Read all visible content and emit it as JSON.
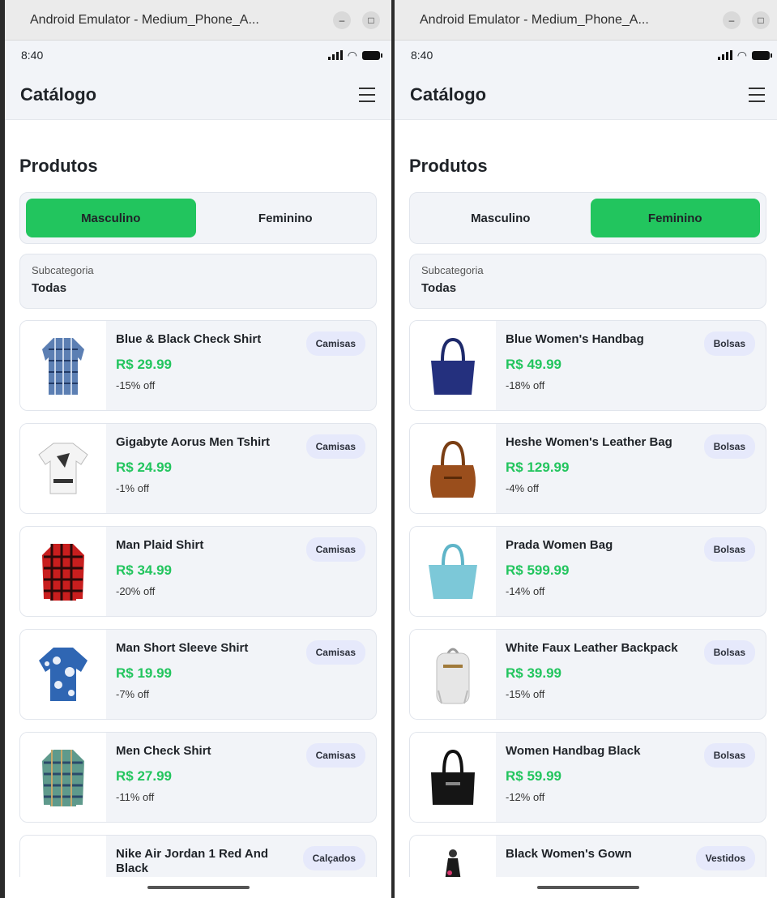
{
  "windows": [
    {
      "title": "Android Emulator - Medium_Phone_A...",
      "status_time": "8:40",
      "app_title": "Catálogo",
      "section_title": "Produtos",
      "segments": [
        {
          "label": "Masculino",
          "active": true
        },
        {
          "label": "Feminino",
          "active": false
        }
      ],
      "subcategory_label": "Subcategoria",
      "subcategory_value": "Todas",
      "products": [
        {
          "name": "Blue & Black Check Shirt",
          "price": "R$ 29.99",
          "discount": "-15% off",
          "category": "Camisas",
          "image": "shirt-blue-check-icon"
        },
        {
          "name": "Gigabyte Aorus Men Tshirt",
          "price": "R$ 24.99",
          "discount": "-1% off",
          "category": "Camisas",
          "image": "tshirt-white-icon"
        },
        {
          "name": "Man Plaid Shirt",
          "price": "R$ 34.99",
          "discount": "-20% off",
          "category": "Camisas",
          "image": "shirt-red-plaid-icon"
        },
        {
          "name": "Man Short Sleeve Shirt",
          "price": "R$ 19.99",
          "discount": "-7% off",
          "category": "Camisas",
          "image": "shirt-blue-floral-icon"
        },
        {
          "name": "Men Check Shirt",
          "price": "R$ 27.99",
          "discount": "-11% off",
          "category": "Camisas",
          "image": "shirt-green-check-icon"
        },
        {
          "name": "Nike Air Jordan 1 Red And Black",
          "price": "",
          "discount": "",
          "category": "Calçados",
          "image": "sneaker-red-black-icon"
        }
      ]
    },
    {
      "title": "Android Emulator - Medium_Phone_A...",
      "status_time": "8:40",
      "app_title": "Catálogo",
      "section_title": "Produtos",
      "segments": [
        {
          "label": "Masculino",
          "active": false
        },
        {
          "label": "Feminino",
          "active": true
        }
      ],
      "subcategory_label": "Subcategoria",
      "subcategory_value": "Todas",
      "products": [
        {
          "name": "Blue Women's Handbag",
          "price": "R$ 49.99",
          "discount": "-18% off",
          "category": "Bolsas",
          "image": "handbag-blue-icon"
        },
        {
          "name": "Heshe Women's Leather Bag",
          "price": "R$ 129.99",
          "discount": "-4% off",
          "category": "Bolsas",
          "image": "handbag-brown-icon"
        },
        {
          "name": "Prada Women Bag",
          "price": "R$ 599.99",
          "discount": "-14% off",
          "category": "Bolsas",
          "image": "handbag-lightblue-icon"
        },
        {
          "name": "White Faux Leather Backpack",
          "price": "R$ 39.99",
          "discount": "-15% off",
          "category": "Bolsas",
          "image": "backpack-white-icon"
        },
        {
          "name": "Women Handbag Black",
          "price": "R$ 59.99",
          "discount": "-12% off",
          "category": "Bolsas",
          "image": "handbag-black-icon"
        },
        {
          "name": "Black Women's Gown",
          "price": "",
          "discount": "",
          "category": "Vestidos",
          "image": "gown-black-icon"
        }
      ]
    }
  ],
  "colors": {
    "accent": "#22c55e",
    "card_bg": "#f2f4f8",
    "badge_bg": "#e6e9fb"
  }
}
